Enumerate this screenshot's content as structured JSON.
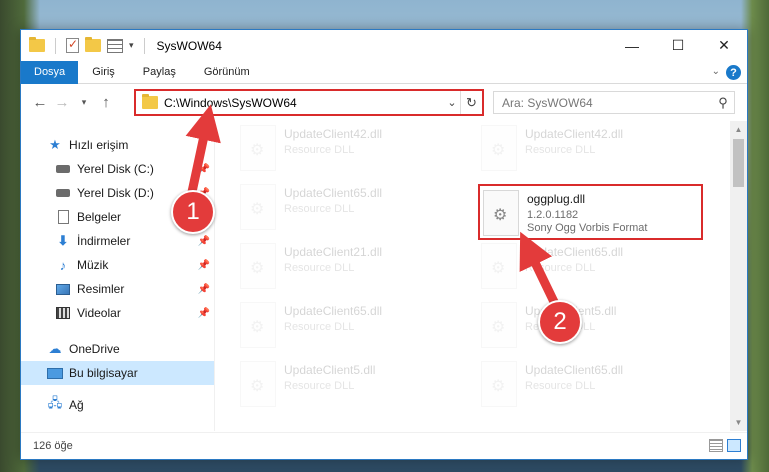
{
  "window": {
    "title": "SysWOW64"
  },
  "ribbon": {
    "tabs": [
      {
        "label": "Dosya"
      },
      {
        "label": "Giriş"
      },
      {
        "label": "Paylaş"
      },
      {
        "label": "Görünüm"
      }
    ],
    "help": "?"
  },
  "navigation": {
    "address": "C:\\Windows\\SysWOW64",
    "search_placeholder": "Ara: SysWOW64"
  },
  "sidebar": {
    "items": [
      {
        "label": "Hızlı erişim",
        "icon": "star-icon"
      },
      {
        "label": "Yerel Disk (C:)",
        "icon": "drive-icon",
        "pinned": true
      },
      {
        "label": "Yerel Disk (D:)",
        "icon": "drive-icon",
        "pinned": true
      },
      {
        "label": "Belgeler",
        "icon": "document-icon",
        "pinned": true
      },
      {
        "label": "İndirmeler",
        "icon": "download-icon",
        "pinned": true
      },
      {
        "label": "Müzik",
        "icon": "music-icon",
        "pinned": true
      },
      {
        "label": "Resimler",
        "icon": "pictures-icon",
        "pinned": true
      },
      {
        "label": "Videolar",
        "icon": "videos-icon",
        "pinned": true
      },
      {
        "label": "OneDrive",
        "icon": "cloud-icon"
      },
      {
        "label": "Bu bilgisayar",
        "icon": "computer-icon",
        "selected": true
      },
      {
        "label": "Ağ",
        "icon": "network-icon"
      }
    ]
  },
  "files": {
    "left": [
      {
        "name": "UpdateClient42.dll",
        "desc": "Resource DLL"
      },
      {
        "name": "UpdateClient65.dll",
        "desc": "Resource DLL"
      },
      {
        "name": "UpdateClient21.dll",
        "desc": "Resource DLL"
      },
      {
        "name": "UpdateClient65.dll",
        "desc": "Resource DLL"
      },
      {
        "name": "UpdateClient5.dll",
        "desc": "Resource DLL"
      }
    ],
    "right": [
      {
        "name": "UpdateClient42.dll",
        "desc": "Resource DLL"
      },
      {
        "name": "UpdateClient65.dll",
        "desc": "Resource DLL"
      },
      {
        "name": "UpdateClient5.dll",
        "desc": "Resource DLL"
      },
      {
        "name": "UpdateClient65.dll",
        "desc": "Resource DLL"
      }
    ],
    "highlighted": {
      "name": "oggplug.dll",
      "version": "1.2.0.1182",
      "desc": "Sony Ogg Vorbis Format"
    }
  },
  "status": {
    "item_count": "126 öğe"
  },
  "annotations": {
    "step1": "1",
    "step2": "2",
    "color": "#e33b3b"
  }
}
